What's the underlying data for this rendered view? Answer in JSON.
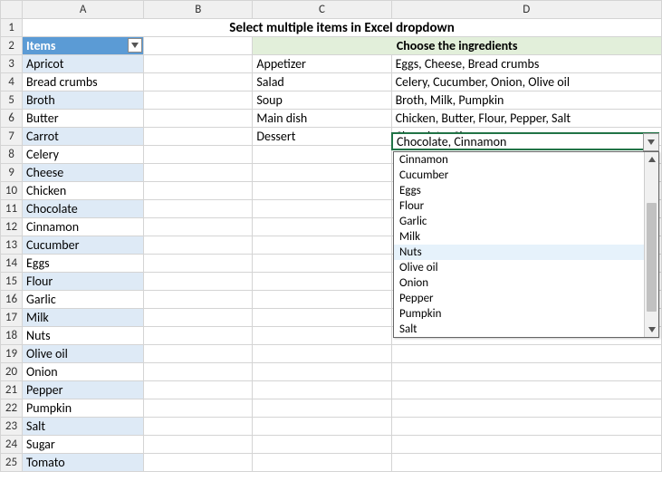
{
  "columns": [
    "A",
    "B",
    "C",
    "D"
  ],
  "title": "Select multiple items in Excel dropdown",
  "items_header": "Items",
  "choose_header": "Choose the ingredients",
  "items": [
    "Apricot",
    "Bread crumbs",
    "Broth",
    "Butter",
    "Carrot",
    "Celery",
    "Cheese",
    "Chicken",
    "Chocolate",
    "Cinnamon",
    "Cucumber",
    "Eggs",
    "Flour",
    "Garlic",
    "Milk",
    "Nuts",
    "Olive oil",
    "Onion",
    "Pepper",
    "Pumpkin",
    "Salt",
    "Sugar",
    "Tomato"
  ],
  "meals": [
    {
      "name": "Appetizer",
      "ingredients": "Eggs, Cheese, Bread crumbs"
    },
    {
      "name": "Salad",
      "ingredients": "Celery, Cucumber, Onion, Olive oil"
    },
    {
      "name": "Soup",
      "ingredients": "Broth, Milk, Pumpkin"
    },
    {
      "name": "Main dish",
      "ingredients": "Chicken, Butter, Flour, Pepper, Salt"
    },
    {
      "name": "Dessert",
      "ingredients": "Chocolate, Cinnamon"
    }
  ],
  "active_cell": {
    "ref": "D7",
    "value": "Chocolate, Cinnamon"
  },
  "dropdown": {
    "items": [
      "Cinnamon",
      "Cucumber",
      "Eggs",
      "Flour",
      "Garlic",
      "Milk",
      "Nuts",
      "Olive oil",
      "Onion",
      "Pepper",
      "Pumpkin",
      "Salt"
    ],
    "hover_index": 6
  }
}
